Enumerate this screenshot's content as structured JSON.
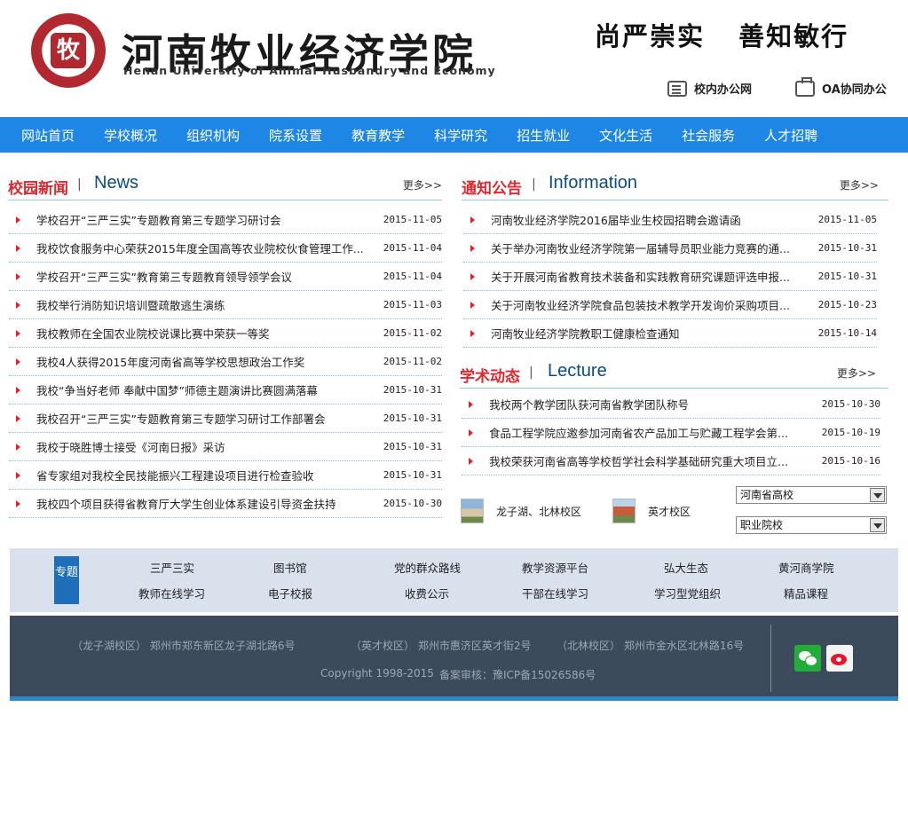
{
  "header": {
    "school_name_cn": "河南牧业经济学院",
    "school_name_en": "Henan University of Animal Husbandry and Economy",
    "motto": "尚严崇实 善知敏行",
    "links": [
      {
        "label": "校内办公网",
        "icon": "document-icon"
      },
      {
        "label": "OA协同办公",
        "icon": "briefcase-icon"
      }
    ]
  },
  "nav": [
    "网站首页",
    "学校概况",
    "组织机构",
    "院系设置",
    "教育教学",
    "科学研究",
    "招生就业",
    "文化生活",
    "社会服务",
    "人才招聘"
  ],
  "news": {
    "title_cn": "校园新闻",
    "sep": "|",
    "title_en": "News",
    "more": "更多>>",
    "items": [
      {
        "title": "学校召开“三严三实”专题教育第三专题学习研讨会",
        "date": "2015-11-05"
      },
      {
        "title": "我校饮食服务中心荣获2015年度全国高等农业院校伙食管理工作...",
        "date": "2015-11-04"
      },
      {
        "title": "学校召开“三严三实”教育第三专题教育领导领学会议",
        "date": "2015-11-04"
      },
      {
        "title": "我校举行消防知识培训暨疏散逃生演练",
        "date": "2015-11-03"
      },
      {
        "title": "我校教师在全国农业院校说课比赛中荣获一等奖",
        "date": "2015-11-02"
      },
      {
        "title": "我校4人获得2015年度河南省高等学校思想政治工作奖",
        "date": "2015-11-02"
      },
      {
        "title": "我校“争当好老师 奉献中国梦”师德主题演讲比赛圆满落幕",
        "date": "2015-10-31"
      },
      {
        "title": "我校召开“三严三实”专题教育第三专题学习研讨工作部署会",
        "date": "2015-10-31"
      },
      {
        "title": "我校于晓胜博士接受《河南日报》采访",
        "date": "2015-10-31"
      },
      {
        "title": "省专家组对我校全民技能振兴工程建设项目进行检查验收",
        "date": "2015-10-31"
      },
      {
        "title": "我校四个项目获得省教育厅大学生创业体系建设引导资金扶持",
        "date": "2015-10-30"
      }
    ]
  },
  "notices": {
    "title_cn": "通知公告",
    "sep": "|",
    "title_en": "Information",
    "more": "更多>>",
    "items": [
      {
        "title": "河南牧业经济学院2016届毕业生校园招聘会邀请函",
        "date": "2015-11-05"
      },
      {
        "title": "关于举办河南牧业经济学院第一届辅导员职业能力竞赛的通...",
        "date": "2015-10-31"
      },
      {
        "title": "关于开展河南省教育技术装备和实践教育研究课题评选申报...",
        "date": "2015-10-31"
      },
      {
        "title": "关于河南牧业经济学院食品包装技术教学开发询价采购项目...",
        "date": "2015-10-23"
      },
      {
        "title": "河南牧业经济学院教职工健康检查通知",
        "date": "2015-10-14"
      }
    ]
  },
  "lecture": {
    "title_cn": "学术动态",
    "sep": "|",
    "title_en": "Lecture",
    "more": "更多>>",
    "items": [
      {
        "title": "我校两个教学团队获河南省教学团队称号",
        "date": "2015-10-30"
      },
      {
        "title": "食品工程学院应邀参加河南省农产品加工与贮藏工程学会第...",
        "date": "2015-10-19"
      },
      {
        "title": "我校荣获河南省高等学校哲学社会科学基础研究重大项目立...",
        "date": "2015-10-16"
      }
    ]
  },
  "campus": [
    {
      "label": "龙子湖、北林校区"
    },
    {
      "label": "英才校区"
    }
  ],
  "selects": [
    {
      "value": "河南省高校"
    },
    {
      "value": "职业院校"
    }
  ],
  "topics": {
    "tag": "专题",
    "links": [
      "三严三实",
      "图书馆",
      "党的群众路线",
      "教学资源平台",
      "弘大生态",
      "黄河商学院",
      "教师在线学习",
      "电子校报",
      "收费公示",
      "干部在线学习",
      "学习型党组织",
      "精品课程"
    ]
  },
  "footer": {
    "addresses": [
      "（龙子湖校区） 郑州市郑东新区龙子湖北路6号",
      "（英才校区） 郑州市惠济区英才街2号",
      "（北林校区） 郑州市金水区北林路16号"
    ],
    "copyright": "Copyright 1998-2015",
    "icp": "备案审核：豫ICP备15026586号"
  },
  "colors": {
    "nav_bg": "#1e87e6",
    "accent_red": "#e0282f",
    "title_blue": "#0c4a8a",
    "footer_bg": "#3c4b5c",
    "topics_bg": "#d9e2ec"
  }
}
